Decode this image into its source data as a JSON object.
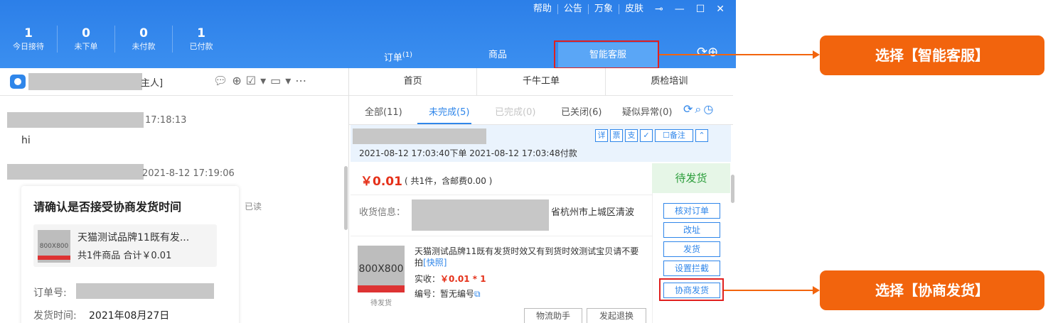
{
  "window_controls": {
    "help": "帮助",
    "notice": "公告",
    "wanxiang": "万象",
    "skin": "皮肤",
    "pin": "⊸",
    "minimize": "—",
    "maximize": "☐",
    "close": "✕"
  },
  "stats": [
    {
      "value": "1",
      "label": "今日接待"
    },
    {
      "value": "0",
      "label": "未下单"
    },
    {
      "value": "0",
      "label": "未付款"
    },
    {
      "value": "1",
      "label": "已付款"
    }
  ],
  "main_tabs": {
    "order": "订单",
    "order_count": "(1)",
    "goods": "商品",
    "smart_service": "智能客服"
  },
  "chat": {
    "header_name_suffix": "主人]",
    "msg1_time": "17:18:13",
    "msg1_text": "hi",
    "msg2_time": "2021-8-12 17:19:06",
    "read_status": "已读",
    "card": {
      "title": "请确认是否接受协商发货时间",
      "thumb": "800X800",
      "product_name": "天猫测试品牌11既有发...",
      "product_summary": "共1件商品  合计￥0.01",
      "order_label": "订单号:",
      "ship_label": "发货时间:",
      "ship_value": "2021年08月27日"
    }
  },
  "sub_tabs": [
    "首页",
    "千牛工单",
    "质检培训"
  ],
  "filters": {
    "all": "全部(11)",
    "incomplete": "未完成(5)",
    "done": "已完成(0)",
    "closed": "已关闭(6)",
    "abnormal": "疑似异常(0)"
  },
  "order": {
    "icons": [
      "详",
      "票",
      "支"
    ],
    "note_btn": "☐备注",
    "times": "2021-08-12 17:03:40下单  2021-08-12 17:03:48付款",
    "price": "￥0.01",
    "price_note": "( 共1件，含邮费0.00 )",
    "status": "待发货",
    "receiver_label": "收货信息：",
    "receiver_addr": "省杭州市上城区清波",
    "item_thumb": "800X800",
    "item_status": "待发货",
    "item_name": "天猫测试品牌11既有发货时效又有到货时效测试宝贝请不要拍",
    "item_link": "[快照]",
    "paid_label": "实收：",
    "paid_value": "￥0.01",
    "paid_qty": " * 1",
    "code_label": "编号：暂无编号",
    "actions": [
      "核对订单",
      "改址",
      "发货",
      "设置拦截",
      "协商发货"
    ],
    "logistics_btn": "物流助手",
    "refund_btn": "发起退换"
  },
  "callouts": {
    "smart_service": "选择【智能客服】",
    "negotiate_ship": "选择【协商发货】"
  },
  "colors": {
    "topbar": "#2c7fe8",
    "accent": "#2f86ea",
    "callout": "#f2640d",
    "highlight": "#e0201f",
    "price": "#e5311a",
    "status_green": "#2a9d3a"
  }
}
